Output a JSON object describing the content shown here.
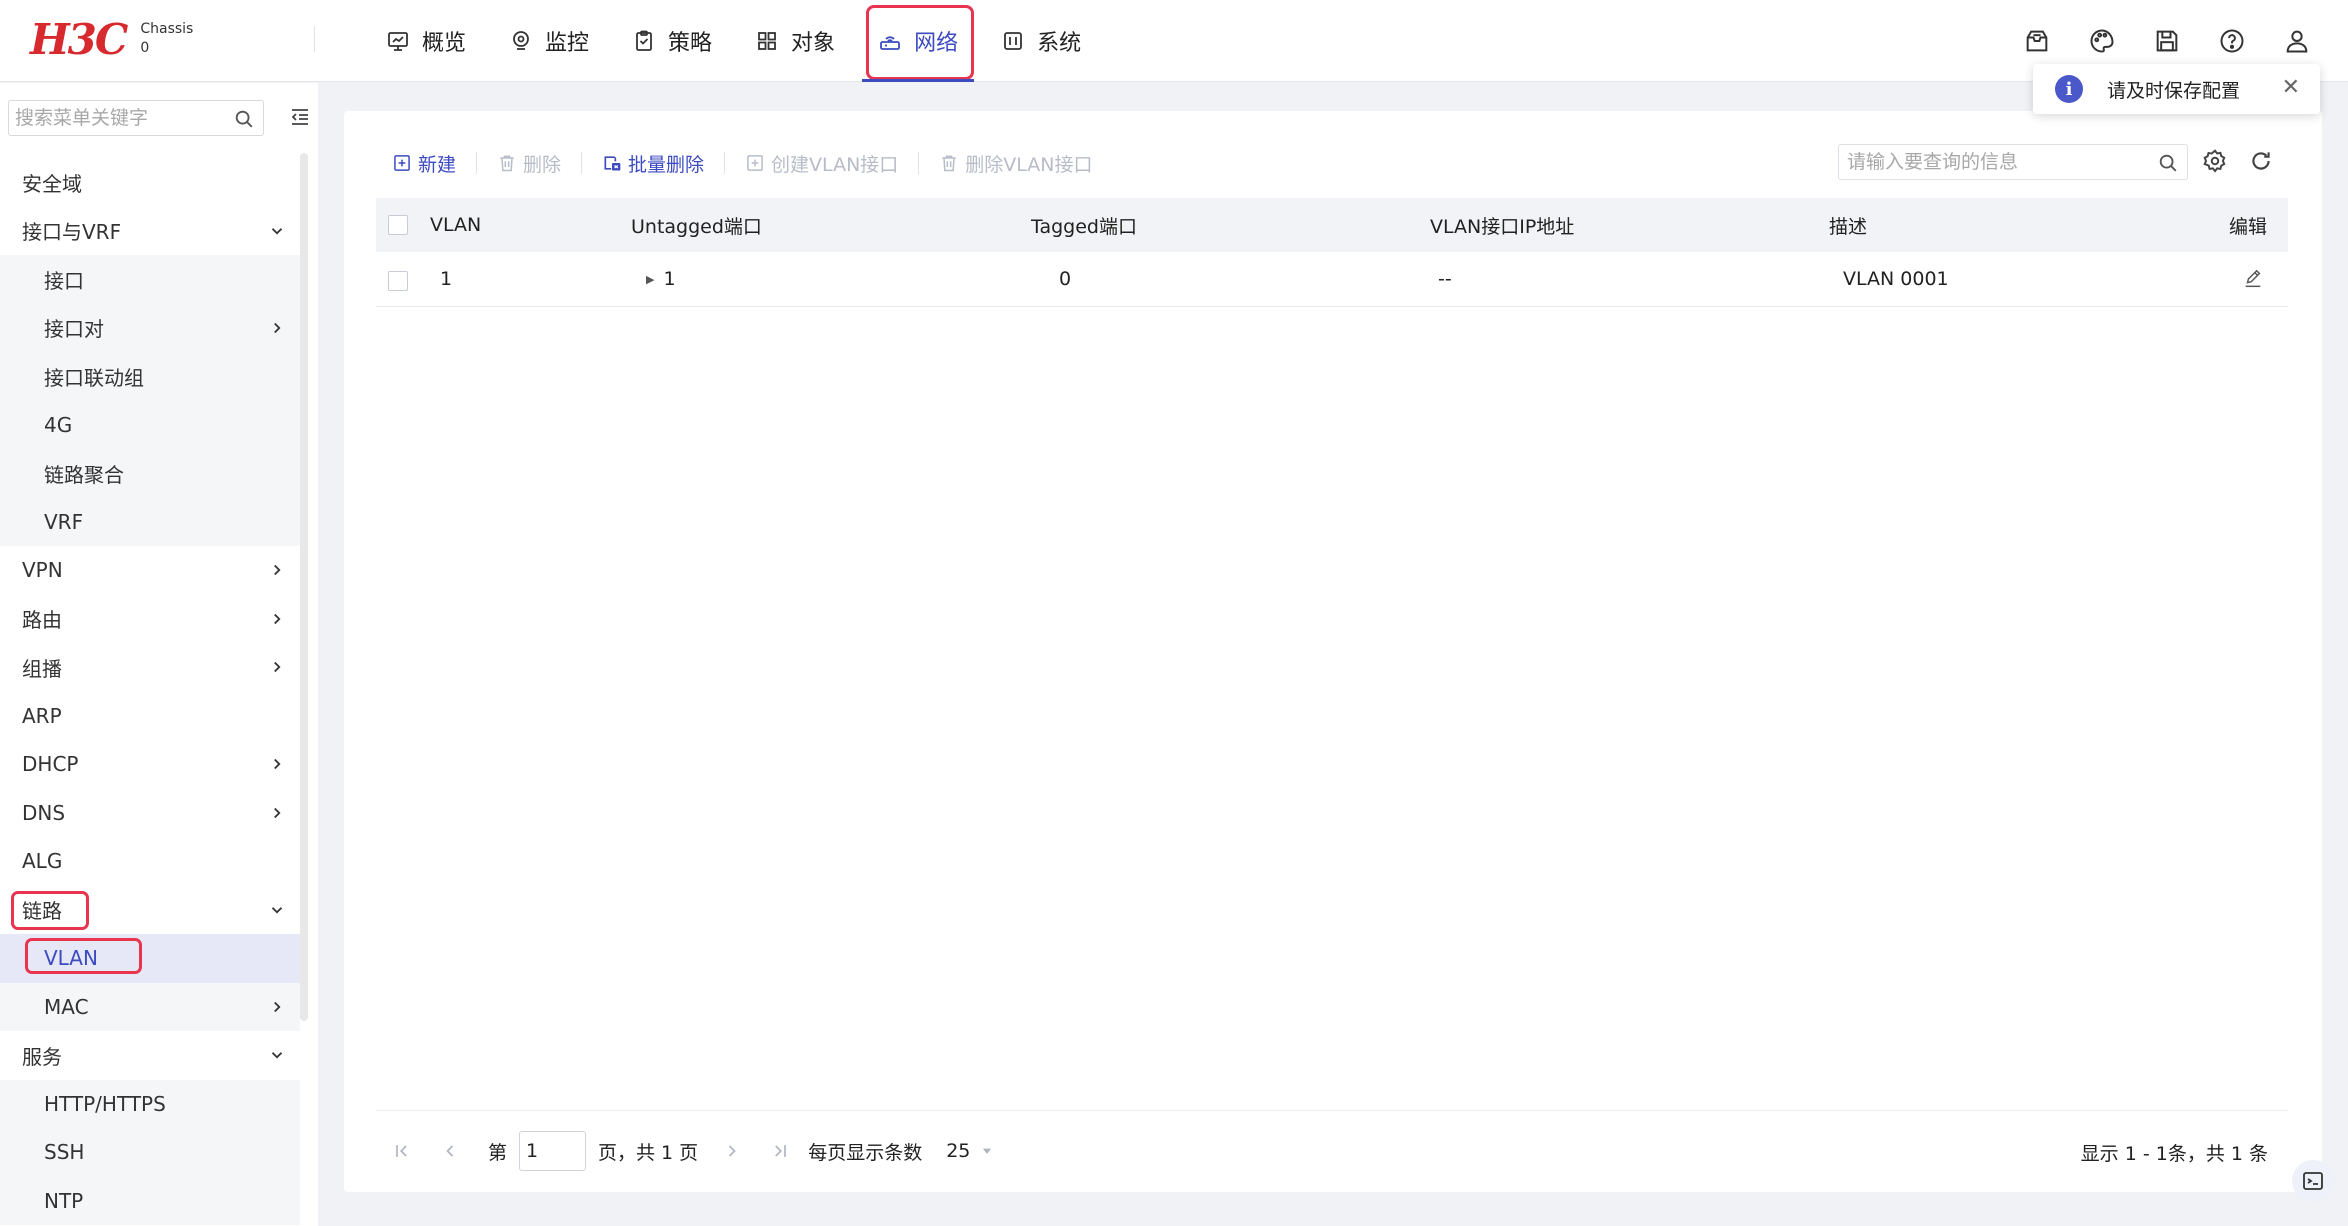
{
  "logo": {
    "brand": "H3C",
    "line1": "Chassis",
    "line2": "0"
  },
  "nav": [
    {
      "label": "概览",
      "icon": "dashboard-icon"
    },
    {
      "label": "监控",
      "icon": "monitor-pin-icon"
    },
    {
      "label": "策略",
      "icon": "clipboard-icon"
    },
    {
      "label": "对象",
      "icon": "grid-icon"
    },
    {
      "label": "网络",
      "icon": "network-icon",
      "active": true
    },
    {
      "label": "系统",
      "icon": "system-icon"
    }
  ],
  "toolbar_icons": [
    "mailbox-icon",
    "palette-icon",
    "save-icon",
    "help-icon",
    "user-icon"
  ],
  "toast": {
    "message": "请及时保存配置",
    "close": "✕"
  },
  "sidebar": {
    "search_placeholder": "搜索菜单关键字",
    "items": [
      {
        "label": "安全域",
        "level": 1
      },
      {
        "label": "接口与VRF",
        "level": 1,
        "expanded": true
      },
      {
        "label": "接口",
        "level": 2
      },
      {
        "label": "接口对",
        "level": 2,
        "has_children": true
      },
      {
        "label": "接口联动组",
        "level": 2
      },
      {
        "label": "4G",
        "level": 2
      },
      {
        "label": "链路聚合",
        "level": 2
      },
      {
        "label": "VRF",
        "level": 2
      },
      {
        "label": "VPN",
        "level": 1,
        "has_children": true
      },
      {
        "label": "路由",
        "level": 1,
        "has_children": true
      },
      {
        "label": "组播",
        "level": 1,
        "has_children": true
      },
      {
        "label": "ARP",
        "level": 1
      },
      {
        "label": "DHCP",
        "level": 1,
        "has_children": true
      },
      {
        "label": "DNS",
        "level": 1,
        "has_children": true
      },
      {
        "label": "ALG",
        "level": 1
      },
      {
        "label": "链路",
        "level": 1,
        "expanded": true
      },
      {
        "label": "VLAN",
        "level": 2,
        "selected": true
      },
      {
        "label": "MAC",
        "level": 2,
        "has_children": true
      },
      {
        "label": "服务",
        "level": 1,
        "expanded": true
      },
      {
        "label": "HTTP/HTTPS",
        "level": 2
      },
      {
        "label": "SSH",
        "level": 2
      },
      {
        "label": "NTP",
        "level": 2
      }
    ]
  },
  "actions": {
    "new": "新建",
    "delete": "删除",
    "batch_delete": "批量删除",
    "create_vlan_if": "创建VLAN接口",
    "delete_vlan_if": "删除VLAN接口"
  },
  "table_search_placeholder": "请输入要查询的信息",
  "table": {
    "headers": [
      "VLAN",
      "Untagged端口",
      "Tagged端口",
      "VLAN接口IP地址",
      "描述",
      "编辑"
    ],
    "rows": [
      {
        "vlan": "1",
        "untagged": "1",
        "tagged": "0",
        "ip": "--",
        "desc": "VLAN 0001"
      }
    ]
  },
  "pagination": {
    "page_prefix": "第",
    "page": "1",
    "page_suffix": "页，共 1 页",
    "per_page_label": "每页显示条数",
    "per_page": "25",
    "summary": "显示 1 - 1条，共 1 条"
  },
  "colors": {
    "accent": "#3d4bc1",
    "brand": "#d72a2e",
    "highlight": "#e8344f"
  }
}
